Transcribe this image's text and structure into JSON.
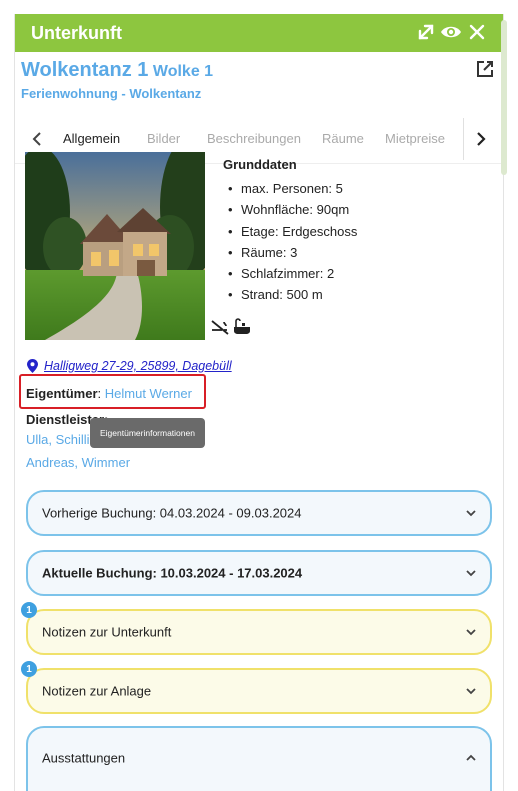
{
  "header": {
    "title": "Unterkunft",
    "icons": [
      "expand-icon",
      "eye-icon",
      "close-icon"
    ],
    "color": "#8dc63f"
  },
  "property": {
    "name": "Wolkentanz 1",
    "unit": "Wolke 1",
    "subtitle": "Ferienwohnung - Wolkentanz"
  },
  "tabs": {
    "items": [
      {
        "label": "Allgemein",
        "active": true
      },
      {
        "label": "Bilder",
        "active": false
      },
      {
        "label": "Beschreibungen",
        "active": false
      },
      {
        "label": "Räume",
        "active": false
      },
      {
        "label": "Mietpreise",
        "active": false
      }
    ]
  },
  "grunddaten": {
    "title": "Grunddaten",
    "items": [
      "max. Personen: 5",
      "Wohnfläche: 90qm",
      "Etage: Erdgeschoss",
      "Räume: 3",
      "Schlafzimmer: 2",
      "Strand: 500 m"
    ],
    "amenity_icons": [
      "no-smoking-icon",
      "bathtub-icon"
    ]
  },
  "address": "Halligweg 27-29, 25899, Dagebüll",
  "owner": {
    "label": "Eigentümer",
    "name": "Helmut Werner"
  },
  "tooltip": "Eigentümerinformationen",
  "dienstleister": {
    "label": "Dienstleister:",
    "line1": "Ulla, Schilli",
    "line2": "Andreas, Wimmer"
  },
  "accordions": [
    {
      "label": "Vorherige Buchung: 04.03.2024 - 09.03.2024",
      "style": "blue",
      "bold": false,
      "badge": null,
      "expanded": false
    },
    {
      "label": "Aktuelle Buchung: 10.03.2024 - 17.03.2024",
      "style": "blue",
      "bold": true,
      "badge": null,
      "expanded": false
    },
    {
      "label": "Notizen zur Unterkunft",
      "style": "yellow",
      "bold": false,
      "badge": "1",
      "expanded": false
    },
    {
      "label": "Notizen zur Anlage",
      "style": "yellow",
      "bold": false,
      "badge": "1",
      "expanded": false
    },
    {
      "label": "Ausstattungen",
      "style": "blue",
      "bold": false,
      "badge": null,
      "expanded": true
    }
  ],
  "colors": {
    "accent_green": "#8dc63f",
    "link_blue": "#5aa9e6",
    "highlight_red": "#d81f26",
    "accordion_blue_border": "#7cc3ea",
    "accordion_yellow_border": "#f0e16a"
  }
}
